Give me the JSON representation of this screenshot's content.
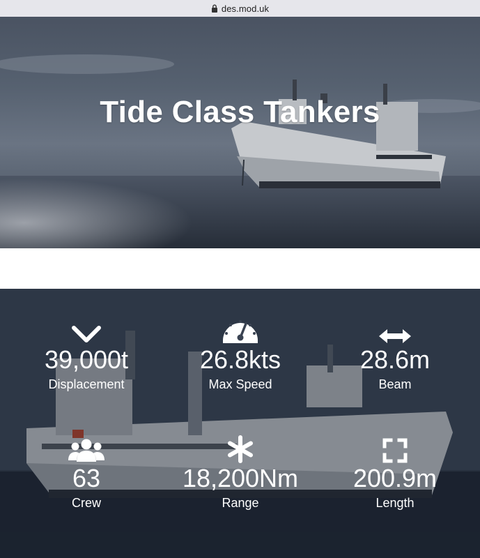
{
  "browser": {
    "url": "des.mod.uk",
    "lock_icon": "lock-icon"
  },
  "hero": {
    "title": "Tide Class Tankers"
  },
  "stats": [
    {
      "icon": "chevron-down-icon",
      "value": "39,000t",
      "label": "Displacement"
    },
    {
      "icon": "speedometer-icon",
      "value": "26.8kts",
      "label": "Max Speed"
    },
    {
      "icon": "double-arrow-horizontal-icon",
      "value": "28.6m",
      "label": "Beam"
    },
    {
      "icon": "users-icon",
      "value": "63",
      "label": "Crew"
    },
    {
      "icon": "asterisk-icon",
      "value": "18,200Nm",
      "label": "Range"
    },
    {
      "icon": "expand-corners-icon",
      "value": "200.9m",
      "label": "Length"
    }
  ],
  "colors": {
    "text": "#ffffff",
    "url_bar": "#e6e6eb",
    "overlay": "#2a3342"
  }
}
